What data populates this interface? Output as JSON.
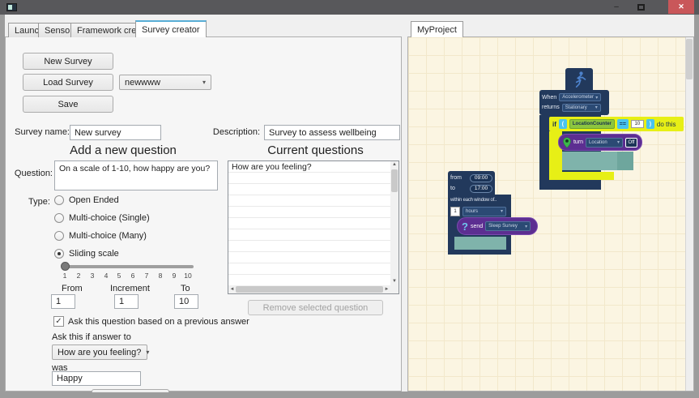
{
  "window": {
    "glyphs": {
      "minimize": "–",
      "close": "✕",
      "dropdown_arrow": "▾",
      "check": "✓",
      "scroll_up": "▲",
      "scroll_down": "▼",
      "scroll_left": "◄",
      "scroll_right": "►"
    }
  },
  "tabs": {
    "items": [
      {
        "label": "Launch"
      },
      {
        "label": "Sensors"
      },
      {
        "label": "Framework creator"
      },
      {
        "label": "Survey creator"
      }
    ],
    "active": "Survey creator"
  },
  "left": {
    "buttons": {
      "new_survey": "New Survey",
      "load_survey": "Load Survey",
      "save": "Save",
      "remove": "Remove selected question"
    },
    "load_combo_value": "newwww",
    "survey_name": {
      "label": "Survey name:",
      "value": "New survey"
    },
    "description": {
      "label": "Description:",
      "value": "Survey to assess wellbeing"
    },
    "headings": {
      "add": "Add a new question",
      "current": "Current questions"
    },
    "question": {
      "label": "Question:",
      "value": "On a scale of 1-10, how happy are you?"
    },
    "type": {
      "label": "Type:",
      "options": [
        {
          "label": "Open Ended",
          "selected": false
        },
        {
          "label": "Multi-choice (Single)",
          "selected": false
        },
        {
          "label": "Multi-choice (Many)",
          "selected": false
        },
        {
          "label": "Sliding scale",
          "selected": true
        }
      ]
    },
    "slider": {
      "value": "1",
      "ticks": [
        "1",
        "2",
        "3",
        "4",
        "5",
        "6",
        "7",
        "8",
        "9",
        "10"
      ]
    },
    "range": {
      "from_label": "From",
      "increment_label": "Increment",
      "to_label": "To",
      "from_value": "1",
      "increment_value": "1",
      "to_value": "10"
    },
    "followup": {
      "checked": true,
      "checkbox_label": "Ask this question based on a previous answer",
      "ask_label": "Ask this if answer to",
      "question_value": "How are you feeling?",
      "was_label": "was",
      "was_value": "Happy"
    },
    "current_questions": [
      "How are you feeling?"
    ]
  },
  "right": {
    "tab_label": "MyProject",
    "blocks": {
      "when": {
        "when_label": "When",
        "sensor": "Accelerometer",
        "returns_label": "returns",
        "state": "Stationary"
      },
      "if": {
        "if_label": "if",
        "open_paren": "(",
        "variable": "LocationCounter",
        "operator": "==",
        "value": "10",
        "close_paren": ")",
        "do_label": "do this"
      },
      "turn": {
        "label": "turn",
        "target": "Location",
        "state": "Off"
      },
      "schedule": {
        "from_label": "from",
        "from_time": "09:00",
        "to_label": "to",
        "to_time": "17:00",
        "window_label": "within each window of..",
        "window_value": "1",
        "window_unit": "hours"
      },
      "send": {
        "icon": "?",
        "label": "send",
        "survey": "Sleep Survey"
      }
    }
  },
  "colors": {
    "navy_block": "#22395c",
    "yellow_block": "#e7ef16",
    "purple_block": "#5c2e91",
    "cyan_chip": "#49c3ee",
    "green_chip": "#8dc63f",
    "teal_slot": "#7fb3ab",
    "canvas": "#fbf5e2",
    "close_button": "#c9575a",
    "active_tab_accent": "#58aed6"
  }
}
